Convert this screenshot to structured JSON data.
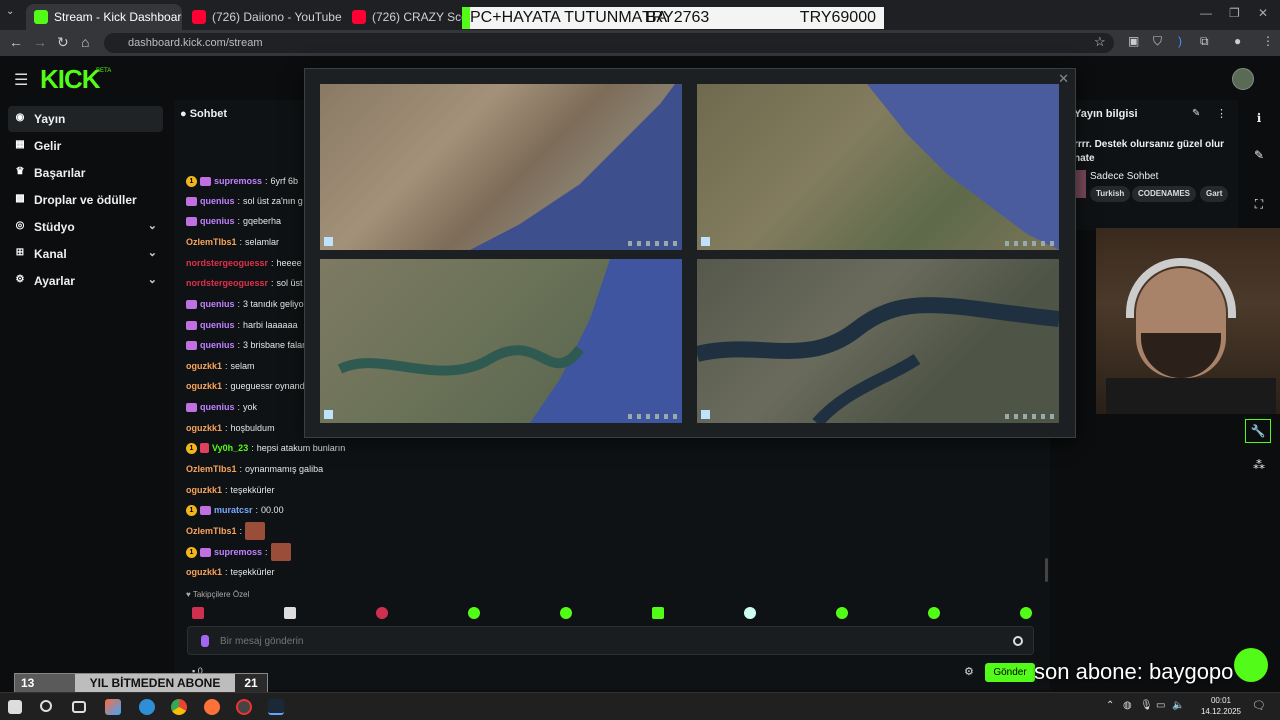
{
  "browser": {
    "tabs": [
      {
        "title": "Stream - Kick Dashboard",
        "icon": "kick-icon",
        "color": "#53fc18"
      },
      {
        "title": "(726) Daiiono - YouTube",
        "icon": "youtube-icon",
        "color": "#ff0033"
      },
      {
        "title": "(726) CRAZY Scenes and Al",
        "icon": "youtube-icon",
        "color": "#ff0033"
      }
    ],
    "url": "dashboard.kick.com/stream"
  },
  "overlay_banner": {
    "text": "PC+HAYATA TUTUNMA BA",
    "amount": "TRY2763",
    "goal": "TRY69000"
  },
  "kick": {
    "logo": "KICK",
    "beta": "BETA"
  },
  "sidebar": {
    "items": [
      {
        "label": "Yayın",
        "icon": "broadcast-icon"
      },
      {
        "label": "Gelir",
        "icon": "revenue-icon"
      },
      {
        "label": "Başarılar",
        "icon": "trophy-icon"
      },
      {
        "label": "Droplar ve ödüller",
        "icon": "gift-icon"
      },
      {
        "label": "Stüdyo",
        "icon": "studio-icon"
      },
      {
        "label": "Kanal",
        "icon": "channel-icon"
      },
      {
        "label": "Ayarlar",
        "icon": "gear-icon"
      }
    ]
  },
  "chat": {
    "title": "Sohbet",
    "messages": [
      {
        "user": "supremoss",
        "text": "6yrf 6b",
        "color": "#c080ff"
      },
      {
        "user": "quenius",
        "text": "sol üst za'nın g",
        "color": "#c080ff"
      },
      {
        "user": "quenius",
        "text": "gqeberha",
        "color": "#c080ff"
      },
      {
        "user": "OzlemTlbs1",
        "text": "selamlar",
        "color": "#f7a55b"
      },
      {
        "user": "nordstergeoguessr",
        "text": "heeee",
        "color": "#e0304c"
      },
      {
        "user": "nordstergeoguessr",
        "text": "sol üst",
        "color": "#e0304c"
      },
      {
        "user": "quenius",
        "text": "3 tanıdık geliyo",
        "color": "#c080ff"
      },
      {
        "user": "quenius",
        "text": "harbi laaaaaa",
        "color": "#c080ff"
      },
      {
        "user": "quenius",
        "text": "3 brisbane falan",
        "color": "#c080ff"
      },
      {
        "user": "oguzkk1",
        "text": "selam",
        "color": "#f7a55b"
      },
      {
        "user": "oguzkk1",
        "text": "gueguessr oynand",
        "color": "#f7a55b"
      },
      {
        "user": "quenius",
        "text": "yok",
        "color": "#c080ff"
      },
      {
        "user": "oguzkk1",
        "text": "hoşbuldum",
        "color": "#f7a55b"
      },
      {
        "user": "Vy0h_23",
        "text": "hepsi atakum bunların",
        "color": "#53fc18"
      },
      {
        "user": "OzlemTlbs1",
        "text": "oynanmamış galiba",
        "color": "#f7a55b"
      },
      {
        "user": "oguzkk1",
        "text": "teşekkürler",
        "color": "#f7a55b"
      },
      {
        "user": "muratcsr",
        "text": "00.00",
        "color": "#7aa8ff"
      },
      {
        "user": "OzlemTlbs1",
        "text": "",
        "color": "#f7a55b"
      },
      {
        "user": "supremoss",
        "text": "",
        "color": "#c080ff"
      },
      {
        "user": "oguzkk1",
        "text": "teşekkürler",
        "color": "#f7a55b"
      }
    ],
    "sub_only_label": "Takipçilere Özel",
    "input_placeholder": "Bir mesaj gönderin",
    "send_label": "Gönder",
    "count": "0"
  },
  "stream_info": {
    "title": "Yayın bilgisi",
    "description": "rrrr. Destek olursanız güzel olur nate",
    "category": "Sadece Sohbet",
    "tags": [
      "Turkish",
      "CODENAMES",
      "Gart"
    ]
  },
  "bottom_overlay": {
    "left": "13",
    "center": "YIL BİTMEDEN ABONE",
    "right": "21"
  },
  "last_sub": "son abone: baygopo",
  "taskbar": {
    "time": "00:01",
    "date": "14.12.2025"
  }
}
